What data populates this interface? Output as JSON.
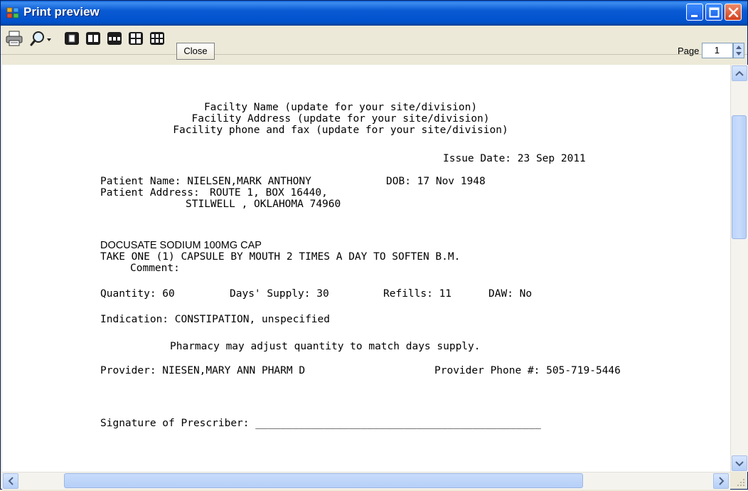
{
  "window": {
    "title": "Print preview"
  },
  "toolbar": {
    "print_icon": "printer-icon",
    "zoom_icon": "magnifier-icon",
    "close_label": "Close",
    "page_label": "Page",
    "page_value": "1"
  },
  "document": {
    "facility_name": "Facilty Name (update for your site/division)",
    "facility_address": "Facility Address (update for your site/division)",
    "facility_phone": "Facility phone and fax (update for your site/division)",
    "issue_date": "Issue Date: 23 Sep 2011",
    "patient_name_label": "Patient Name: NIELSEN,MARK ANTHONY",
    "dob": "DOB: 17 Nov 1948",
    "patient_address_label": "Patient Address:",
    "patient_address_line1": "ROUTE 1, BOX 16440,",
    "patient_address_line2": "STILWELL , OKLAHOMA 74960",
    "drug": "DOCUSATE SODIUM 100MG CAP",
    "sig": "TAKE ONE (1) CAPSULE BY MOUTH 2 TIMES A DAY TO SOFTEN B.M.",
    "comment": "Comment:",
    "quantity": "Quantity: 60",
    "days_supply": "Days' Supply: 30",
    "refills": "Refills: 11",
    "daw": "DAW: No",
    "indication": "Indication: CONSTIPATION, unspecified",
    "pharmacy_note": "Pharmacy may adjust quantity to match days supply.",
    "provider": "Provider: NIESEN,MARY ANN PHARM D",
    "provider_phone": "Provider Phone #: 505-719-5446",
    "signature": "Signature of Prescriber: ______________________________________________"
  }
}
